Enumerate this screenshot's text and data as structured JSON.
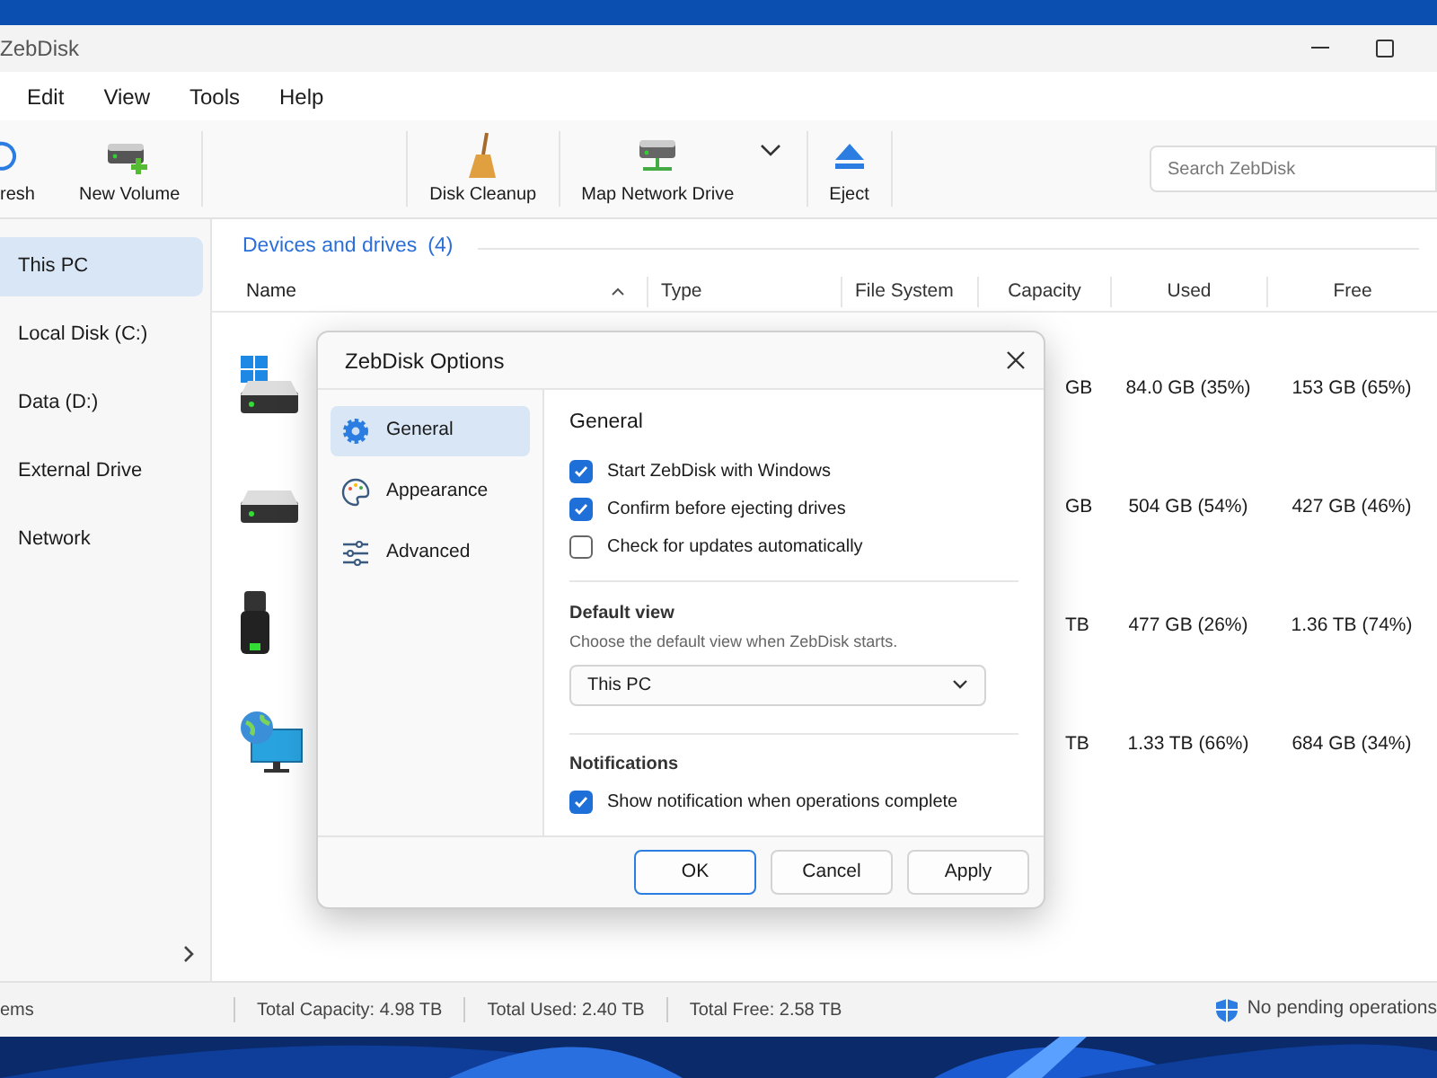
{
  "window": {
    "title": "ZebDisk"
  },
  "menu": [
    {
      "label": "Edit"
    },
    {
      "label": "View"
    },
    {
      "label": "Tools"
    },
    {
      "label": "Help"
    }
  ],
  "toolbar": [
    {
      "label": "resh",
      "kind": "refresh"
    },
    {
      "label": "New Volume",
      "kind": "new-volume"
    },
    {
      "label": "Disk Cleanup",
      "kind": "cleanup"
    },
    {
      "label": "Map Network Drive",
      "kind": "network"
    },
    {
      "label": "Eject",
      "kind": "eject"
    }
  ],
  "search": {
    "placeholder": "Search ZebDisk"
  },
  "sidebar": {
    "items": [
      {
        "label": "This PC",
        "selected": true
      },
      {
        "label": "Local Disk (C:)",
        "selected": false
      },
      {
        "label": "Data (D:)",
        "selected": false
      },
      {
        "label": "External Drive",
        "selected": false
      },
      {
        "label": "Network",
        "selected": false
      }
    ]
  },
  "group": {
    "title": "Devices and drives",
    "count": "(4)"
  },
  "table": {
    "columns": [
      {
        "label": "Name",
        "sorted": true
      },
      {
        "label": "Type",
        "sorted": false
      },
      {
        "label": "File System",
        "sorted": false
      },
      {
        "label": "Capacity",
        "sorted": false
      },
      {
        "label": "Used",
        "sorted": false
      },
      {
        "label": "Free",
        "sorted": false
      }
    ],
    "rows": [
      {
        "kind": "system",
        "capacity": "GB",
        "used": "84.0 GB (35%)",
        "free": "153 GB (65%)"
      },
      {
        "kind": "disk",
        "capacity": "GB",
        "used": "504 GB (54%)",
        "free": "427 GB (46%)"
      },
      {
        "kind": "usb",
        "capacity": "TB",
        "used": "477 GB (26%)",
        "free": "1.36 TB (74%)"
      },
      {
        "kind": "network",
        "capacity": "TB",
        "used": "1.33 TB (66%)",
        "free": "684 GB (34%)"
      }
    ]
  },
  "dialog": {
    "title": "ZebDisk Options",
    "nav": [
      {
        "label": "General",
        "kind": "gear",
        "selected": true
      },
      {
        "label": "Appearance",
        "kind": "palette",
        "selected": false
      },
      {
        "label": "Advanced",
        "kind": "sliders",
        "selected": false
      }
    ],
    "heading": "General",
    "options": [
      {
        "label": "Start ZebDisk with Windows",
        "checked": true
      },
      {
        "label": "Confirm before ejecting drives",
        "checked": true
      },
      {
        "label": "Check for updates automatically",
        "checked": false
      }
    ],
    "default_view": {
      "heading": "Default view",
      "description": "Choose the default view when ZebDisk starts.",
      "value": "This PC"
    },
    "notifications": {
      "heading": "Notifications",
      "options": [
        {
          "label": "Show notification when operations complete",
          "checked": true
        }
      ]
    },
    "buttons": [
      {
        "label": "OK",
        "default": true
      },
      {
        "label": "Cancel",
        "default": false
      },
      {
        "label": "Apply",
        "default": false
      }
    ]
  },
  "status_bar": {
    "items": [
      "ems",
      "Total Capacity: 4.98 TB",
      "Total Used: 2.40 TB",
      "Total Free: 2.58 TB"
    ],
    "status": "No pending operations"
  }
}
